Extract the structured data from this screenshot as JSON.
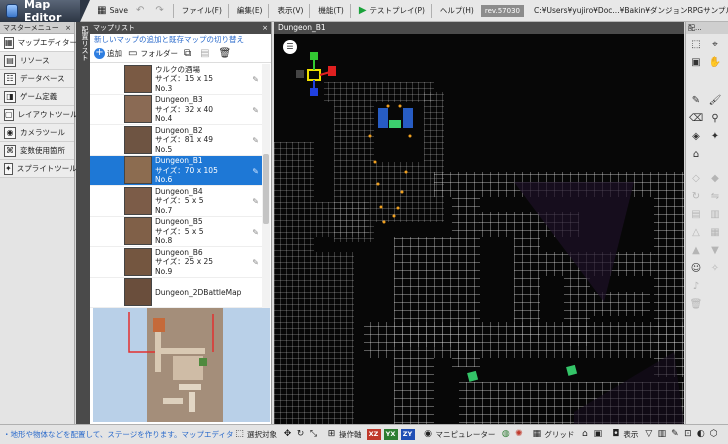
{
  "app": {
    "title": "Map Editor",
    "save_label": "Save",
    "menus": [
      "ファイル(F)",
      "編集(E)",
      "表示(V)",
      "機能(T)"
    ],
    "test_play": "テストプレイ(P)",
    "help": "ヘルプ(H)",
    "revision": "rev.57030",
    "path": "C:¥Users¥yujiro¥Doc...¥Bakin¥ダンジョンRPGサンプル"
  },
  "master_menu": {
    "title": "マスターメニュー",
    "items": [
      {
        "label": "マップエディター",
        "icon": "map-icon"
      },
      {
        "label": "リソース",
        "icon": "resource-icon"
      },
      {
        "label": "データベース",
        "icon": "database-icon"
      },
      {
        "label": "ゲーム定義",
        "icon": "game-icon"
      },
      {
        "label": "レイアウトツール",
        "icon": "layout-icon"
      },
      {
        "label": "カメラツール",
        "icon": "camera-icon"
      },
      {
        "label": "変数使用箇所",
        "icon": "variable-icon"
      },
      {
        "label": "スプライトツール",
        "icon": "sprite-icon"
      }
    ]
  },
  "side_tab": {
    "label": "配置リスト"
  },
  "map_list": {
    "title": "マップリスト",
    "subtitle": "新しいマップの追加と既存マップの切り替え",
    "add_label": "追加",
    "folder_label": "フォルダー",
    "items": [
      {
        "name": "ウルクの酒場",
        "size": "サイズ：15 x 15",
        "no": "No.3"
      },
      {
        "name": "Dungeon_B3",
        "size": "サイズ：32 x 40",
        "no": "No.4"
      },
      {
        "name": "Dungeon_B2",
        "size": "サイズ：81 x 49",
        "no": "No.5"
      },
      {
        "name": "Dungeon_B1",
        "size": "サイズ：70 x 105",
        "no": "No.6"
      },
      {
        "name": "Dungeon_B4",
        "size": "サイズ：5 x 5",
        "no": "No.7"
      },
      {
        "name": "Dungeon_B5",
        "size": "サイズ：5 x 5",
        "no": "No.8"
      },
      {
        "name": "Dungeon_B6",
        "size": "サイズ：25 x 25",
        "no": "No.9"
      },
      {
        "name": "Dungeon_2DBattleMap",
        "size": "",
        "no": ""
      }
    ],
    "selected_index": 3
  },
  "viewport": {
    "title": "Dungeon_B1"
  },
  "right_toolbar": {
    "title": "配..."
  },
  "status_bar": {
    "message": "・地形や物体などを配置して、ステージを作ります。マップエディター内の各種",
    "select_target": "選択対象",
    "operation": "操作軸",
    "axes": [
      {
        "label": "XZ",
        "color": "#c0392b"
      },
      {
        "label": "YX",
        "color": "#2e7d32"
      },
      {
        "label": "ZY",
        "color": "#1f4fb5"
      }
    ],
    "manipulator": "マニピュレーター",
    "grid": "グリッド",
    "display": "表示"
  },
  "colors": {
    "accent": "#1e78d6",
    "link_text": "#2a6acb",
    "panel_header": "#4b4b4b"
  }
}
